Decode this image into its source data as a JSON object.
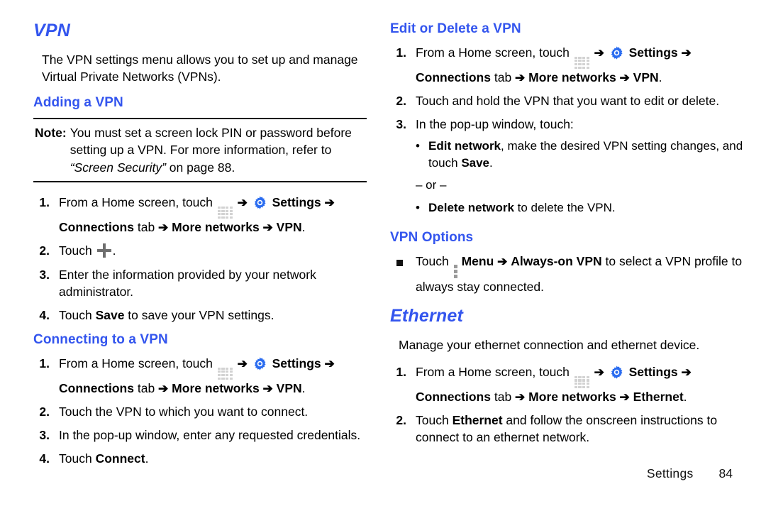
{
  "left_column": {
    "title": "VPN",
    "intro": "The VPN settings menu allows you to set up and manage Virtual Private Networks (VPNs).",
    "adding_section": {
      "heading": "Adding a VPN",
      "note": {
        "label": "Note:",
        "text_part1": "You must set a screen lock PIN or password before setting up a VPN. For more information, refer to ",
        "text_italic": "“Screen Security”",
        "text_part2": " on page 88."
      },
      "steps": [
        {
          "num": "1.",
          "seg1": "From a Home screen, touch ",
          "arrow": "➔",
          "seg2": "Settings",
          "seg3": "Connections",
          "seg4": " tab ",
          "seg5": "More networks",
          "seg6": "VPN",
          "seg7": "."
        },
        {
          "num": "2.",
          "seg1": "Touch ",
          "seg2": "."
        },
        {
          "num": "3.",
          "seg1": "Enter the information provided by your network administrator."
        },
        {
          "num": "4.",
          "seg1": "Touch ",
          "bold": "Save",
          "seg2": " to save your VPN settings."
        }
      ]
    },
    "connecting_section": {
      "heading": "Connecting to a VPN",
      "steps": [
        {
          "num": "1.",
          "seg1": "From a Home screen, touch ",
          "seg2": "Settings",
          "seg3": "Connections",
          "seg4": " tab ",
          "seg5": "More networks",
          "seg6": "VPN",
          "seg7": "."
        },
        {
          "num": "2.",
          "seg1": "Touch the VPN to which you want to connect."
        },
        {
          "num": "3.",
          "seg1": "In the pop-up window, enter any requested credentials."
        },
        {
          "num": "4.",
          "seg1": "Touch ",
          "bold": "Connect",
          "seg2": "."
        }
      ]
    }
  },
  "right_column": {
    "edit_delete_section": {
      "heading": "Edit or Delete a VPN",
      "steps": [
        {
          "num": "1.",
          "seg1": "From a Home screen, touch ",
          "seg2": "Settings",
          "seg3": "Connections",
          "seg4": " tab ",
          "seg5": "More networks",
          "seg6": "VPN",
          "seg7": "."
        },
        {
          "num": "2.",
          "seg1": "Touch and hold the VPN that you want to edit or delete."
        },
        {
          "num": "3.",
          "seg1": "In the pop-up window, touch:"
        }
      ],
      "sub_items": {
        "bullet": "•",
        "item1_bold": "Edit network",
        "item1_text": ", make the desired VPN setting changes, and touch ",
        "item1_bold2": "Save",
        "item1_end": ".",
        "or_label": "– or –",
        "item2_bold": "Delete network",
        "item2_text": " to delete the VPN."
      }
    },
    "vpn_options_section": {
      "heading": "VPN Options",
      "item": {
        "seg1": "Touch ",
        "seg2": "Menu",
        "seg3": "Always-on VPN",
        "seg4": " to select a VPN profile to always stay connected."
      }
    },
    "ethernet_section": {
      "title": "Ethernet",
      "intro": "Manage your ethernet connection and ethernet device.",
      "steps": [
        {
          "num": "1.",
          "seg1": "From a Home screen, touch ",
          "seg2": "Settings",
          "seg3": "Connections",
          "seg4": " tab ",
          "seg5": "More networks",
          "seg6": "Ethernet",
          "seg7": "."
        },
        {
          "num": "2.",
          "seg1": "Touch ",
          "bold": "Ethernet",
          "seg2": " and follow the onscreen instructions to connect to an ethernet network."
        }
      ]
    }
  },
  "footer": {
    "label": "Settings",
    "page": "84"
  },
  "icons": {
    "apps": "apps-grid-icon",
    "settings": "settings-gear-icon",
    "plus": "plus-icon",
    "menu": "menu-dots-icon",
    "arrow": "➔"
  },
  "colors": {
    "heading_blue": "#3355ee",
    "text_black": "#000000",
    "gear_blue": "#2a6cf0",
    "icon_gray": "#d2d2d2"
  }
}
